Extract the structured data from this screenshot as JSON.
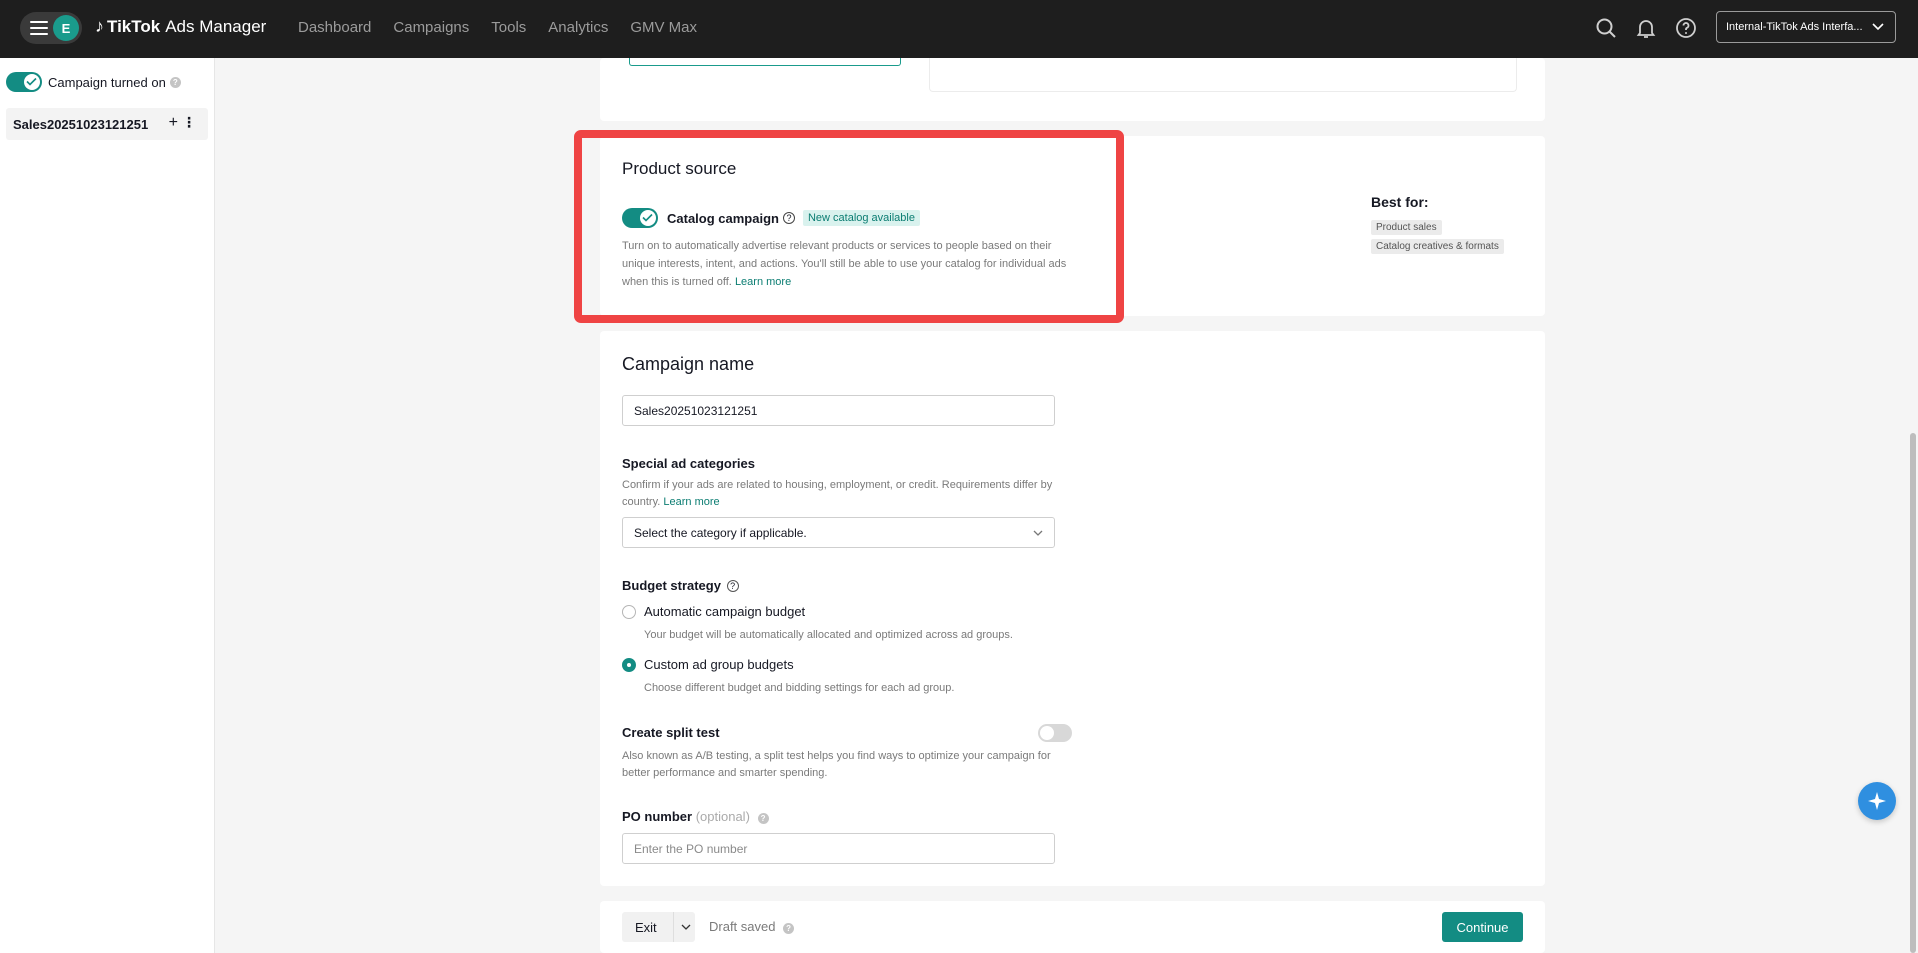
{
  "header": {
    "avatar_letter": "E",
    "brand_name": "TikTok",
    "brand_suffix": "Ads Manager",
    "nav": [
      "Dashboard",
      "Campaigns",
      "Tools",
      "Analytics",
      "GMV Max"
    ],
    "account": "Internal-TikTok Ads Interfa...",
    "icons": [
      "search-icon",
      "bell-icon",
      "help-icon"
    ]
  },
  "sidebar": {
    "status_label": "Campaign turned on",
    "campaign_item": "Sales20251023121251",
    "plus": "+",
    "more": "⋮"
  },
  "product_source": {
    "title": "Product source",
    "toggle_label": "Catalog campaign",
    "badge": "New catalog available",
    "description": "Turn on to automatically advertise relevant products or services to people based on their unique interests, intent, and actions. You'll still be able to use your catalog for individual ads when this is turned off.",
    "learn_more": "Learn more",
    "best_for_title": "Best for:",
    "best_for": [
      "Product sales",
      "Catalog creatives & formats"
    ]
  },
  "campaign": {
    "title": "Campaign name",
    "name_value": "Sales20251023121251",
    "special_label": "Special ad categories",
    "special_desc": "Confirm if your ads are related to housing, employment, or credit. Requirements differ by country.",
    "special_learn": "Learn more",
    "special_placeholder": "Select the category if applicable.",
    "budget_label": "Budget strategy",
    "budget_options": [
      {
        "label": "Automatic campaign budget",
        "desc": "Your budget will be automatically allocated and optimized across ad groups.",
        "selected": false
      },
      {
        "label": "Custom ad group budgets",
        "desc": "Choose different budget and bidding settings for each ad group.",
        "selected": true
      }
    ],
    "split_label": "Create split test",
    "split_desc": "Also known as A/B testing, a split test helps you find ways to optimize your campaign for better performance and smarter spending.",
    "po_label": "PO number",
    "po_optional": "(optional)",
    "po_placeholder": "Enter the PO number"
  },
  "footer": {
    "exit": "Exit",
    "draft": "Draft saved",
    "continue": "Continue"
  },
  "colors": {
    "accent": "#138c83",
    "highlight": "#ef4444",
    "topbar": "#1e1e1e"
  }
}
